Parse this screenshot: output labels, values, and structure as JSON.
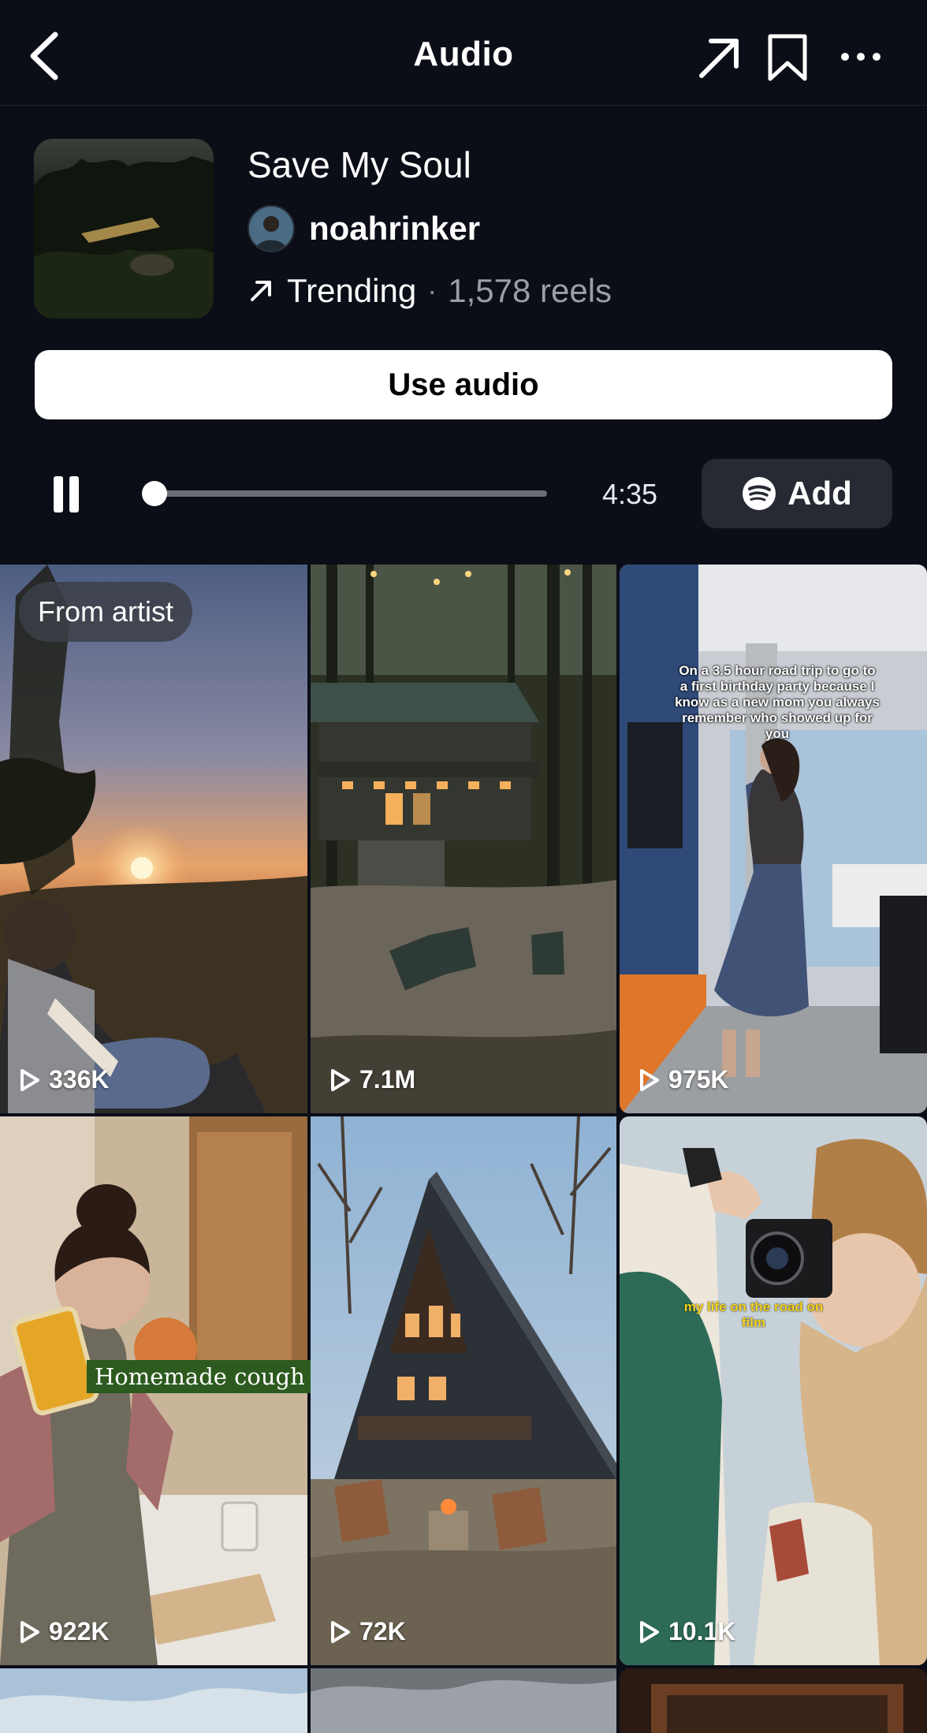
{
  "header": {
    "title": "Audio",
    "back_icon": "chevron-left-icon",
    "share_icon": "arrow-up-right-icon",
    "save_icon": "bookmark-icon",
    "more_icon": "more-horizontal-icon"
  },
  "audio": {
    "title": "Save My Soul",
    "artist": "noahrinker",
    "trending_label": "Trending",
    "separator": "·",
    "reel_count": "1,578 reels"
  },
  "use_audio_label": "Use audio",
  "player": {
    "duration": "4:35",
    "progress": 0.02,
    "add_label": "Add",
    "spotify_icon": "spotify-icon"
  },
  "grid": {
    "badge": "From artist",
    "tiles": [
      {
        "views": "336K"
      },
      {
        "views": "7.1M"
      },
      {
        "views": "975K",
        "overlay": "On a 3.5 hour road trip to go to a first birthday party because I know as a new mom you always remember who showed up for you"
      },
      {
        "views": "922K",
        "overlay": "Homemade cough syrup"
      },
      {
        "views": "72K"
      },
      {
        "views": "10.1K",
        "overlay": "my life on the road on film"
      }
    ]
  },
  "colors": {
    "background": "#0b0e17",
    "button_light": "#ffffff",
    "button_dark": "#262a33"
  }
}
